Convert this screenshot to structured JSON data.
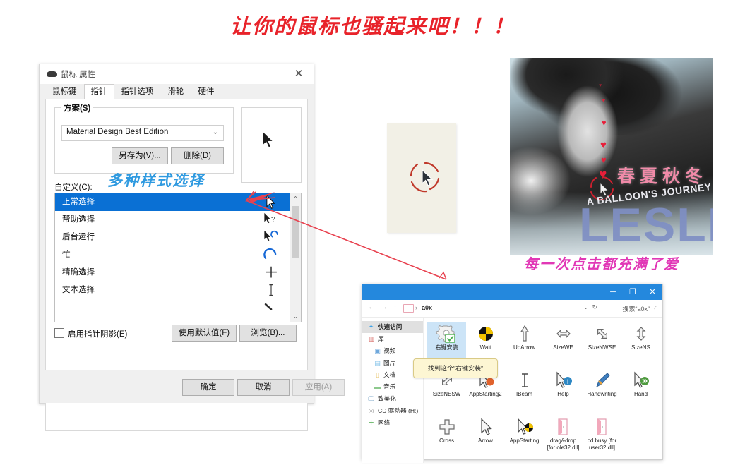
{
  "headline": "让你的鼠标也骚起来吧！！！",
  "annotations": {
    "blue_note": "多种样式选择",
    "pink_note": "每一次点击都充满了爱",
    "arrow_color": "#e8414f",
    "blue_color": "#2f9ae0",
    "pink_color": "#e138b6",
    "headline_color": "#e8232a"
  },
  "mouse_dialog": {
    "title": "鼠标 属性",
    "close_icon": "✕",
    "tabs": [
      {
        "label": "鼠标键",
        "active": false
      },
      {
        "label": "指针",
        "active": true
      },
      {
        "label": "指针选项",
        "active": false
      },
      {
        "label": "滑轮",
        "active": false
      },
      {
        "label": "硬件",
        "active": false
      }
    ],
    "scheme": {
      "legend": "方案(S)",
      "value": "Material Design Best Edition",
      "chevron": "⌄",
      "save_as": "另存为(V)...",
      "delete": "删除(D)"
    },
    "customize_label": "自定义(C):",
    "cursor_items": [
      {
        "label": "正常选择",
        "icon": "normal-select",
        "selected": true
      },
      {
        "label": "帮助选择",
        "icon": "help-select",
        "selected": false
      },
      {
        "label": "后台运行",
        "icon": "working-in-background",
        "selected": false
      },
      {
        "label": "忙",
        "icon": "busy",
        "selected": false
      },
      {
        "label": "精确选择",
        "icon": "precision-select",
        "selected": false
      },
      {
        "label": "文本选择",
        "icon": "text-select",
        "selected": false
      }
    ],
    "scroll_up": "⌃",
    "scroll_down": "⌄",
    "shadow_checkbox": "启用指针阴影(E)",
    "shadow_checked": false,
    "use_default": "使用默认值(F)",
    "browse": "浏览(B)...",
    "ok": "确定",
    "cancel": "取消",
    "apply": "应用(A)",
    "apply_enabled": false
  },
  "photo": {
    "title_cn": "春夏秋冬",
    "subtitle": "A BALLOON'S JOURNEY",
    "artist": "LESLIE"
  },
  "explorer": {
    "title_buttons": {
      "minimize": "─",
      "maximize": "❐",
      "close": "✕"
    },
    "nav": {
      "back": "←",
      "forward": "→",
      "up": "↑"
    },
    "path": "a0x",
    "path_separator": "›",
    "chevron": "⌄",
    "refresh": "↻",
    "search_placeholder": "搜索“a0x”",
    "search_icon": "⌕",
    "sidebar": [
      {
        "label": "快速访问",
        "icon": "star-icon",
        "indent": false,
        "highlight": true
      },
      {
        "label": "库",
        "icon": "library-icon",
        "indent": false,
        "highlight": false
      },
      {
        "label": "视频",
        "icon": "video-icon",
        "indent": true,
        "highlight": false
      },
      {
        "label": "图片",
        "icon": "picture-icon",
        "indent": true,
        "highlight": false
      },
      {
        "label": "文档",
        "icon": "document-icon",
        "indent": true,
        "highlight": false
      },
      {
        "label": "音乐",
        "icon": "music-icon",
        "indent": true,
        "highlight": false
      },
      {
        "label": "致美化",
        "icon": "monitor-icon",
        "indent": false,
        "highlight": false
      },
      {
        "label": "CD 驱动器 (H:)",
        "icon": "disc-icon",
        "indent": false,
        "highlight": false
      },
      {
        "label": "网络",
        "icon": "network-icon",
        "indent": false,
        "highlight": false
      }
    ],
    "files": [
      {
        "name": "右键安装",
        "icon": "gear-check-icon",
        "selected": true
      },
      {
        "name": "Wait",
        "icon": "wait-icon",
        "selected": false
      },
      {
        "name": "UpArrow",
        "icon": "uparrow-icon",
        "selected": false
      },
      {
        "name": "SizeWE",
        "icon": "sizewe-icon",
        "selected": false
      },
      {
        "name": "SizeNWSE",
        "icon": "sizenwse-icon",
        "selected": false
      },
      {
        "name": "SizeNS",
        "icon": "sizens-icon",
        "selected": false
      },
      {
        "name": "SizeNESW",
        "icon": "sizenesw-icon",
        "selected": false
      },
      {
        "name": "AppStarting2",
        "icon": "appstarting-icon",
        "selected": false
      },
      {
        "name": "IBeam",
        "icon": "ibeam-icon",
        "selected": false
      },
      {
        "name": "Help",
        "icon": "help-icon",
        "selected": false
      },
      {
        "name": "Handwriting",
        "icon": "handwriting-icon",
        "selected": false
      },
      {
        "name": "Hand",
        "icon": "hand-icon",
        "selected": false
      },
      {
        "name": "Cross",
        "icon": "cross-icon",
        "selected": false
      },
      {
        "name": "Arrow",
        "icon": "arrow-icon",
        "selected": false
      },
      {
        "name": "AppStarting",
        "icon": "appstarting-icon",
        "selected": false
      },
      {
        "name": "drag&drop [for ole32.dll]",
        "icon": "folder-pink-icon",
        "selected": false
      },
      {
        "name": "cd busy [for user32.dll]",
        "icon": "folder-pink-icon",
        "selected": false
      }
    ],
    "tooltip": "找到这个“右键安装”"
  }
}
